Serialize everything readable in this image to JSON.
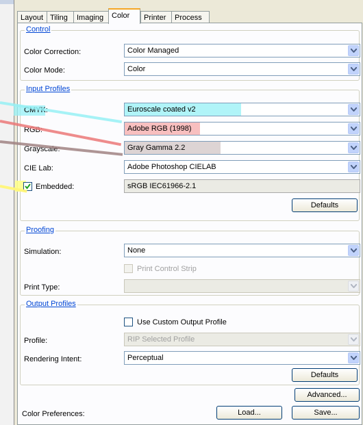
{
  "tabs": [
    "Layout",
    "Tiling",
    "Imaging",
    "Color",
    "Printer",
    "Process"
  ],
  "active_tab": "Color",
  "control": {
    "legend": "Control",
    "color_correction_label": "Color Correction:",
    "color_correction_value": "Color Managed",
    "color_mode_label": "Color Mode:",
    "color_mode_value": "Color"
  },
  "input_profiles": {
    "legend": "Input Profiles",
    "cmyk_label": "CMYK:",
    "cmyk_value": "Euroscale coated v2",
    "rgb_label": "RGB:",
    "rgb_value": "Adobe RGB (1998)",
    "grayscale_label": "Grayscale:",
    "grayscale_value": "Gray Gamma 2.2",
    "cielab_label": "CIE Lab:",
    "cielab_value": "Adobe Photoshop CIELAB",
    "embedded_label": "Embedded:",
    "embedded_checked": true,
    "embedded_value": "sRGB IEC61966-2.1",
    "defaults_button": "Defaults"
  },
  "proofing": {
    "legend": "Proofing",
    "simulation_label": "Simulation:",
    "simulation_value": "None",
    "print_control_strip_label": "Print Control Strip",
    "print_type_label": "Print Type:",
    "print_type_value": ""
  },
  "output_profiles": {
    "legend": "Output Profiles",
    "use_custom_label": "Use Custom Output Profile",
    "profile_label": "Profile:",
    "profile_value": "RIP Selected Profile",
    "rendering_intent_label": "Rendering Intent:",
    "rendering_intent_value": "Perceptual",
    "defaults_button": "Defaults"
  },
  "footer": {
    "advanced_button": "Advanced...",
    "color_preferences_label": "Color Preferences:",
    "load_button": "Load...",
    "save_button": "Save..."
  },
  "colors": {
    "highlight_cyan": "#96f0f5",
    "highlight_red": "#f5aaaa",
    "highlight_gray": "#d7cdcd",
    "highlight_yellow": "#ffff8c",
    "legend_blue": "#0046d5"
  }
}
